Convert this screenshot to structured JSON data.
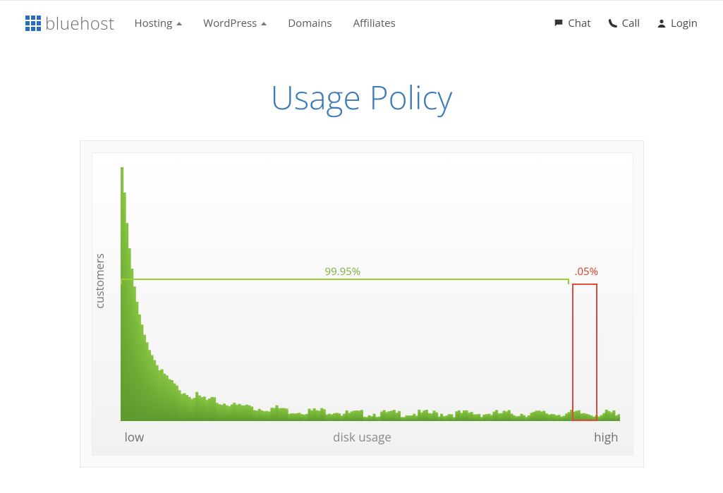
{
  "brand": {
    "name": "bluehost"
  },
  "nav": {
    "hosting": "Hosting",
    "wordpress": "WordPress",
    "domains": "Domains",
    "affiliates": "Affiliates"
  },
  "header_right": {
    "chat": "Chat",
    "call": "Call",
    "login": "Login"
  },
  "page": {
    "title": "Usage Policy"
  },
  "chart_data": {
    "type": "bar",
    "title": "",
    "xlabel": "disk usage",
    "ylabel": "customers",
    "xticks": [
      "low",
      "high"
    ],
    "ylim": [
      0,
      100
    ],
    "annotations": {
      "low_bucket_pct": "99.95%",
      "high_bucket_pct": ".05%"
    },
    "values": [
      100,
      90,
      78,
      68,
      60,
      53,
      47,
      42,
      38,
      34,
      31,
      28,
      26,
      24,
      22,
      20,
      19,
      18,
      17,
      16,
      15,
      14,
      13,
      13,
      12,
      12,
      11,
      11,
      10,
      10,
      10,
      9,
      9,
      9,
      8,
      8,
      8,
      8,
      8,
      7,
      7,
      7,
      7,
      7,
      7,
      6,
      6,
      6,
      6,
      6,
      6,
      6,
      6,
      5,
      5,
      5,
      5,
      5,
      5,
      5,
      5,
      5,
      5,
      5,
      5,
      5,
      4,
      4,
      4,
      4,
      4,
      4,
      4,
      4,
      4,
      4,
      4,
      4,
      4,
      4,
      4,
      4,
      4,
      4,
      4,
      4,
      4,
      4,
      3,
      3,
      3,
      3,
      3,
      3,
      3,
      3,
      3,
      3,
      3,
      3,
      3,
      3,
      3,
      3,
      3,
      3,
      3,
      3,
      3,
      3,
      3,
      3,
      3,
      3,
      3,
      3,
      3,
      3,
      3,
      3,
      3,
      3,
      3,
      3,
      3,
      3,
      3,
      3,
      3,
      3,
      3,
      3,
      3,
      3,
      3,
      3,
      3,
      3,
      3,
      3,
      3,
      3,
      3,
      3,
      3,
      3,
      3,
      3,
      3,
      3,
      3,
      3,
      3,
      3,
      3,
      3,
      3,
      3,
      3,
      3,
      3,
      3,
      3,
      3,
      3,
      3,
      3,
      3,
      3,
      3,
      3,
      3,
      3,
      3,
      3,
      3,
      3,
      3,
      3,
      3,
      3,
      3,
      3,
      3,
      3,
      3,
      3,
      3,
      3,
      3,
      3,
      3,
      3,
      3,
      3,
      3,
      3,
      3,
      2,
      2
    ]
  }
}
